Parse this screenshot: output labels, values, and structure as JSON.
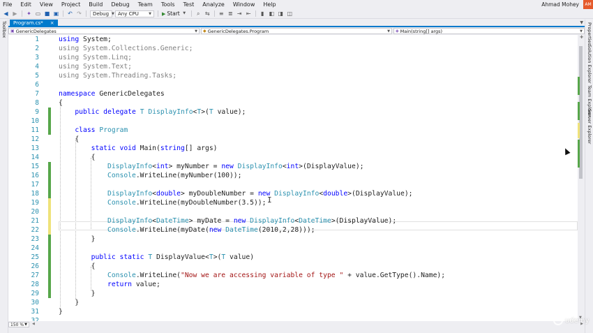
{
  "menu": [
    "File",
    "Edit",
    "View",
    "Project",
    "Build",
    "Debug",
    "Team",
    "Tools",
    "Test",
    "Analyze",
    "Window",
    "Help"
  ],
  "user": {
    "name": "Ahmad Mohey",
    "initials": "AM"
  },
  "toolbar": {
    "configuration": "Debug",
    "platform": "Any CPU",
    "start_label": "Start"
  },
  "side_left": {
    "toolbox": "Toolbox"
  },
  "side_right": {
    "properties": "Properties",
    "solution_explorer": "Solution Explorer",
    "team_explorer": "Team Explorer",
    "server_explorer": "Server Explorer"
  },
  "tab": {
    "title": "Program.cs*",
    "close": "×"
  },
  "nav": {
    "project": "GenericDelegates",
    "type": "GenericDelegates.Program",
    "member": "Main(string[] args)"
  },
  "zoom": "150 %",
  "watermark": "udemy",
  "code_lines": [
    {
      "n": "1",
      "change": "",
      "tokens": [
        {
          "c": "k",
          "v": "using"
        },
        {
          "c": "b",
          "v": " System;"
        }
      ]
    },
    {
      "n": "2",
      "change": "",
      "tokens": [
        {
          "c": "g",
          "v": "using System.Collections.Generic;"
        }
      ]
    },
    {
      "n": "3",
      "change": "",
      "tokens": [
        {
          "c": "g",
          "v": "using System.Linq;"
        }
      ]
    },
    {
      "n": "4",
      "change": "",
      "tokens": [
        {
          "c": "g",
          "v": "using System.Text;"
        }
      ]
    },
    {
      "n": "5",
      "change": "",
      "tokens": [
        {
          "c": "g",
          "v": "using System.Threading.Tasks;"
        }
      ]
    },
    {
      "n": "6",
      "change": "",
      "tokens": []
    },
    {
      "n": "7",
      "change": "",
      "tokens": [
        {
          "c": "k",
          "v": "namespace"
        },
        {
          "c": "b",
          "v": " GenericDelegates"
        }
      ]
    },
    {
      "n": "8",
      "change": "",
      "tokens": [
        {
          "c": "b",
          "v": "{"
        }
      ]
    },
    {
      "n": "9",
      "change": "green",
      "tokens": [
        {
          "c": "b",
          "v": "    "
        },
        {
          "c": "k",
          "v": "public delegate"
        },
        {
          "c": "b",
          "v": " "
        },
        {
          "c": "t",
          "v": "T"
        },
        {
          "c": "b",
          "v": " "
        },
        {
          "c": "t",
          "v": "DisplayInfo"
        },
        {
          "c": "b",
          "v": "<"
        },
        {
          "c": "t",
          "v": "T"
        },
        {
          "c": "b",
          "v": ">("
        },
        {
          "c": "t",
          "v": "T"
        },
        {
          "c": "b",
          "v": " value);"
        }
      ]
    },
    {
      "n": "10",
      "change": "green",
      "tokens": []
    },
    {
      "n": "11",
      "change": "green",
      "tokens": [
        {
          "c": "b",
          "v": "    "
        },
        {
          "c": "k",
          "v": "class"
        },
        {
          "c": "b",
          "v": " "
        },
        {
          "c": "t",
          "v": "Program"
        }
      ]
    },
    {
      "n": "12",
      "change": "",
      "tokens": [
        {
          "c": "b",
          "v": "    {"
        }
      ]
    },
    {
      "n": "13",
      "change": "",
      "tokens": [
        {
          "c": "b",
          "v": "        "
        },
        {
          "c": "k",
          "v": "static void"
        },
        {
          "c": "b",
          "v": " Main("
        },
        {
          "c": "k",
          "v": "string"
        },
        {
          "c": "b",
          "v": "[] args)"
        }
      ]
    },
    {
      "n": "14",
      "change": "",
      "tokens": [
        {
          "c": "b",
          "v": "        {"
        }
      ]
    },
    {
      "n": "15",
      "change": "green",
      "tokens": [
        {
          "c": "b",
          "v": "            "
        },
        {
          "c": "t",
          "v": "DisplayInfo"
        },
        {
          "c": "b",
          "v": "<"
        },
        {
          "c": "k",
          "v": "int"
        },
        {
          "c": "b",
          "v": "> myNumber = "
        },
        {
          "c": "k",
          "v": "new"
        },
        {
          "c": "b",
          "v": " "
        },
        {
          "c": "t",
          "v": "DisplayInfo"
        },
        {
          "c": "b",
          "v": "<"
        },
        {
          "c": "k",
          "v": "int"
        },
        {
          "c": "b",
          "v": ">(DisplayValue);"
        }
      ]
    },
    {
      "n": "16",
      "change": "green",
      "tokens": [
        {
          "c": "b",
          "v": "            "
        },
        {
          "c": "t",
          "v": "Console"
        },
        {
          "c": "b",
          "v": ".WriteLine(myNumber(100));"
        }
      ]
    },
    {
      "n": "17",
      "change": "green",
      "tokens": []
    },
    {
      "n": "18",
      "change": "green",
      "tokens": [
        {
          "c": "b",
          "v": "            "
        },
        {
          "c": "t",
          "v": "DisplayInfo"
        },
        {
          "c": "b",
          "v": "<"
        },
        {
          "c": "k",
          "v": "double"
        },
        {
          "c": "b",
          "v": "> myDoubleNumber = "
        },
        {
          "c": "k",
          "v": "new"
        },
        {
          "c": "b",
          "v": " "
        },
        {
          "c": "t",
          "v": "DisplayInfo"
        },
        {
          "c": "b",
          "v": "<"
        },
        {
          "c": "k",
          "v": "double"
        },
        {
          "c": "b",
          "v": ">(DisplayValue);"
        }
      ]
    },
    {
      "n": "19",
      "change": "yellow",
      "tokens": [
        {
          "c": "b",
          "v": "            "
        },
        {
          "c": "t",
          "v": "Console"
        },
        {
          "c": "b",
          "v": ".WriteLine(myDoubleNumber(3.5));"
        }
      ]
    },
    {
      "n": "20",
      "change": "yellow",
      "tokens": []
    },
    {
      "n": "21",
      "change": "yellow",
      "tokens": [
        {
          "c": "b",
          "v": "            "
        },
        {
          "c": "t",
          "v": "DisplayInfo"
        },
        {
          "c": "b",
          "v": "<"
        },
        {
          "c": "t",
          "v": "DateTime"
        },
        {
          "c": "b",
          "v": "> myDate = "
        },
        {
          "c": "k",
          "v": "new"
        },
        {
          "c": "b",
          "v": " "
        },
        {
          "c": "t",
          "v": "DisplayInfo"
        },
        {
          "c": "b",
          "v": "<"
        },
        {
          "c": "t",
          "v": "DateTime"
        },
        {
          "c": "b",
          "v": ">(DisplayValue);"
        }
      ]
    },
    {
      "n": "22",
      "change": "yellow",
      "tokens": [
        {
          "c": "b",
          "v": "            "
        },
        {
          "c": "t",
          "v": "Console"
        },
        {
          "c": "b",
          "v": ".WriteLine(myDate("
        },
        {
          "c": "k",
          "v": "new"
        },
        {
          "c": "b",
          "v": " "
        },
        {
          "c": "t",
          "v": "DateTime"
        },
        {
          "c": "b",
          "v": "(2010,2,28)));"
        }
      ]
    },
    {
      "n": "23",
      "change": "green",
      "tokens": [
        {
          "c": "b",
          "v": "        }"
        }
      ]
    },
    {
      "n": "24",
      "change": "green",
      "tokens": []
    },
    {
      "n": "25",
      "change": "green",
      "tokens": [
        {
          "c": "b",
          "v": "        "
        },
        {
          "c": "k",
          "v": "public static"
        },
        {
          "c": "b",
          "v": " "
        },
        {
          "c": "t",
          "v": "T"
        },
        {
          "c": "b",
          "v": " DisplayValue<"
        },
        {
          "c": "t",
          "v": "T"
        },
        {
          "c": "b",
          "v": ">("
        },
        {
          "c": "t",
          "v": "T"
        },
        {
          "c": "b",
          "v": " value)"
        }
      ]
    },
    {
      "n": "26",
      "change": "green",
      "tokens": [
        {
          "c": "b",
          "v": "        {"
        }
      ]
    },
    {
      "n": "27",
      "change": "green",
      "tokens": [
        {
          "c": "b",
          "v": "            "
        },
        {
          "c": "t",
          "v": "Console"
        },
        {
          "c": "b",
          "v": ".WriteLine("
        },
        {
          "c": "s",
          "v": "\"Now we are accessing variable of type \""
        },
        {
          "c": "b",
          "v": " + value.GetType().Name);"
        }
      ]
    },
    {
      "n": "28",
      "change": "green",
      "tokens": [
        {
          "c": "b",
          "v": "            "
        },
        {
          "c": "k",
          "v": "return"
        },
        {
          "c": "b",
          "v": " value;"
        }
      ]
    },
    {
      "n": "29",
      "change": "green",
      "tokens": [
        {
          "c": "b",
          "v": "        }"
        }
      ]
    },
    {
      "n": "30",
      "change": "",
      "tokens": [
        {
          "c": "b",
          "v": "    }"
        }
      ]
    },
    {
      "n": "31",
      "change": "",
      "tokens": [
        {
          "c": "b",
          "v": "}"
        }
      ]
    },
    {
      "n": "32",
      "change": "",
      "tokens": []
    }
  ],
  "colors": {
    "keyword": "#0000ff",
    "type": "#2b91af",
    "string": "#a31515",
    "unused": "#808080",
    "accent": "#007acc",
    "change_saved": "#57a64a",
    "change_unsaved": "#efe27a"
  }
}
